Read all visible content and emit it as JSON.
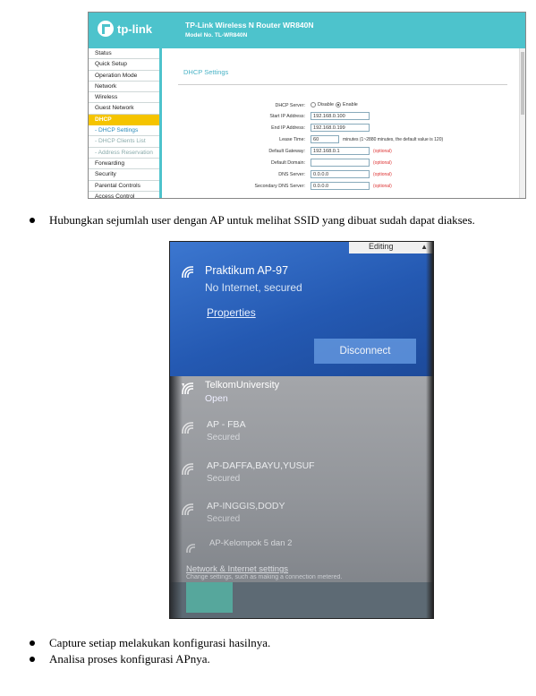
{
  "router": {
    "brand": "tp-link",
    "title": "TP-Link Wireless N Router WR840N",
    "model": "Model No. TL-WR840N",
    "menu": [
      {
        "label": "Status"
      },
      {
        "label": "Quick Setup"
      },
      {
        "label": "Operation Mode"
      },
      {
        "label": "Network"
      },
      {
        "label": "Wireless"
      },
      {
        "label": "Guest Network"
      },
      {
        "label": "DHCP"
      },
      {
        "label": "- DHCP Settings"
      },
      {
        "label": "- DHCP Clients List"
      },
      {
        "label": "- Address Reservation"
      },
      {
        "label": "Forwarding"
      },
      {
        "label": "Security"
      },
      {
        "label": "Parental Controls"
      },
      {
        "label": "Access Control"
      }
    ],
    "page_title": "DHCP Settings",
    "dhcp_server_label": "DHCP Server:",
    "dhcp_disable": "Disable",
    "dhcp_enable": "Enable",
    "start_ip_label": "Start IP Address:",
    "start_ip": "192.168.0.100",
    "end_ip_label": "End IP Address:",
    "end_ip": "192.168.0.199",
    "lease_label": "Lease Time:",
    "lease": "60",
    "lease_note": "minutes (1~2880 minutes, the default value is 120)",
    "gateway_label": "Default Gateway:",
    "gateway": "192.168.0.1",
    "domain_label": "Default Domain:",
    "domain": "",
    "dns_label": "DNS Server:",
    "dns": "0.0.0.0",
    "dns2_label": "Secondary DNS Server:",
    "dns2": "0.0.0.0",
    "optional": "(optional)"
  },
  "text": {
    "bullet1": "Hubungkan sejumlah user dengan AP untuk melihat SSID yang dibuat sudah dapat diakses.",
    "bullet2": "Capture setiap melakukan konfigurasi hasilnya.",
    "bullet3": "Analisa proses konfigurasi APnya."
  },
  "wifi": {
    "editing": "Editing",
    "connected_name": "Praktikum AP-97",
    "connected_status": "No Internet, secured",
    "properties": "Properties",
    "disconnect": "Disconnect",
    "networks": [
      {
        "name": "TelkomUniversity",
        "status": "Open"
      },
      {
        "name": "AP - FBA",
        "status": "Secured"
      },
      {
        "name": "AP-DAFFA,BAYU,YUSUF",
        "status": "Secured"
      },
      {
        "name": "AP-INGGIS,DODY",
        "status": "Secured"
      },
      {
        "name": "AP-Kelompok 5 dan 2",
        "status": ""
      }
    ],
    "settings_link": "Network & Internet settings",
    "settings_sub": "Change settings, such as making a connection metered."
  }
}
